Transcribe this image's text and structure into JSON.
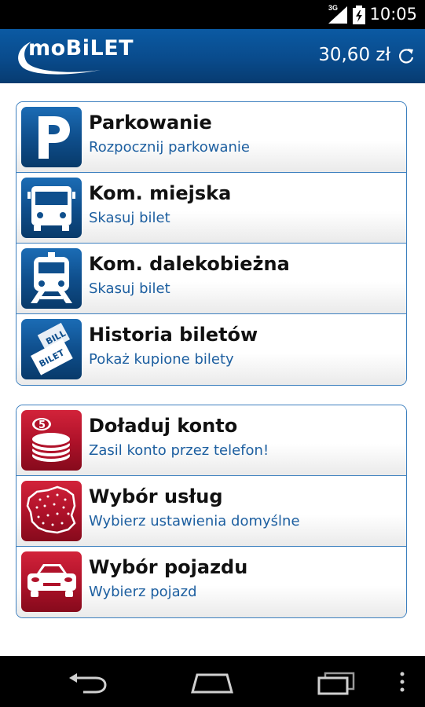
{
  "status_bar": {
    "network": "3G",
    "time": "10:05"
  },
  "header": {
    "logo": "moBiLET",
    "balance": "30,60 zł",
    "refresh_icon": "refresh-icon"
  },
  "menu_group_1": [
    {
      "title": "Parkowanie",
      "subtitle": "Rozpocznij parkowanie",
      "icon": "parking-icon"
    },
    {
      "title": "Kom. miejska",
      "subtitle": "Skasuj bilet",
      "icon": "bus-icon"
    },
    {
      "title": "Kom. dalekobieżna",
      "subtitle": "Skasuj bilet",
      "icon": "train-icon"
    },
    {
      "title": "Historia biletów",
      "subtitle": "Pokaż kupione bilety",
      "icon": "ticket-history-icon"
    }
  ],
  "menu_group_2": [
    {
      "title": "Doładuj konto",
      "subtitle": "Zasil konto przez telefon!",
      "icon": "coins-icon"
    },
    {
      "title": "Wybór usług",
      "subtitle": "Wybierz ustawienia domyślne",
      "icon": "poland-map-icon"
    },
    {
      "title": "Wybór pojazdu",
      "subtitle": "Wybierz pojazd",
      "icon": "car-icon"
    }
  ],
  "ticket_icon_text": {
    "line1": "BILL",
    "line2": "BILET"
  },
  "coin_number": "5",
  "colors": {
    "header_blue": "#094b8c",
    "tile_blue": "#0f4f8d",
    "tile_red": "#b0122a",
    "border_blue": "#3d80bf",
    "subtitle_blue": "#1d5fa0"
  }
}
